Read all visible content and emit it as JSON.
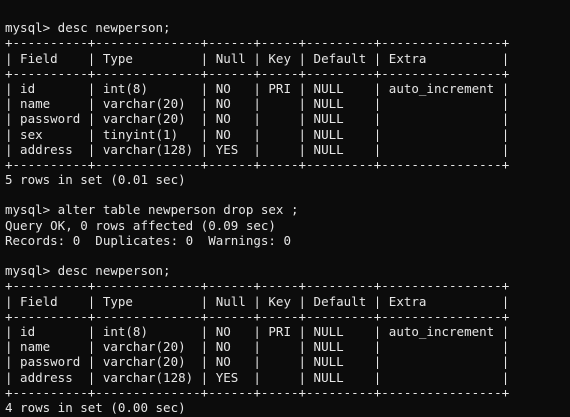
{
  "terminal": {
    "lines": [
      "",
      "mysql> desc newperson;",
      "+----------+--------------+------+-----+---------+----------------+",
      "| Field    | Type         | Null | Key | Default | Extra          |",
      "+----------+--------------+------+-----+---------+----------------+",
      "| id       | int(8)       | NO   | PRI | NULL    | auto_increment |",
      "| name     | varchar(20)  | NO   |     | NULL    |                |",
      "| password | varchar(20)  | NO   |     | NULL    |                |",
      "| sex      | tinyint(1)   | NO   |     | NULL    |                |",
      "| address  | varchar(128) | YES  |     | NULL    |                |",
      "+----------+--------------+------+-----+---------+----------------+",
      "5 rows in set (0.01 sec)",
      "",
      "mysql> alter table newperson drop sex ;",
      "Query OK, 0 rows affected (0.09 sec)",
      "Records: 0  Duplicates: 0  Warnings: 0",
      "",
      "mysql> desc newperson;",
      "+----------+--------------+------+-----+---------+----------------+",
      "| Field    | Type         | Null | Key | Default | Extra          |",
      "+----------+--------------+------+-----+---------+----------------+",
      "| id       | int(8)       | NO   | PRI | NULL    | auto_increment |",
      "| name     | varchar(20)  | NO   |     | NULL    |                |",
      "| password | varchar(20)  | NO   |     | NULL    |                |",
      "| address  | varchar(128) | YES  |     | NULL    |                |",
      "+----------+--------------+------+-----+---------+----------------+",
      "4 rows in set (0.00 sec)"
    ]
  }
}
